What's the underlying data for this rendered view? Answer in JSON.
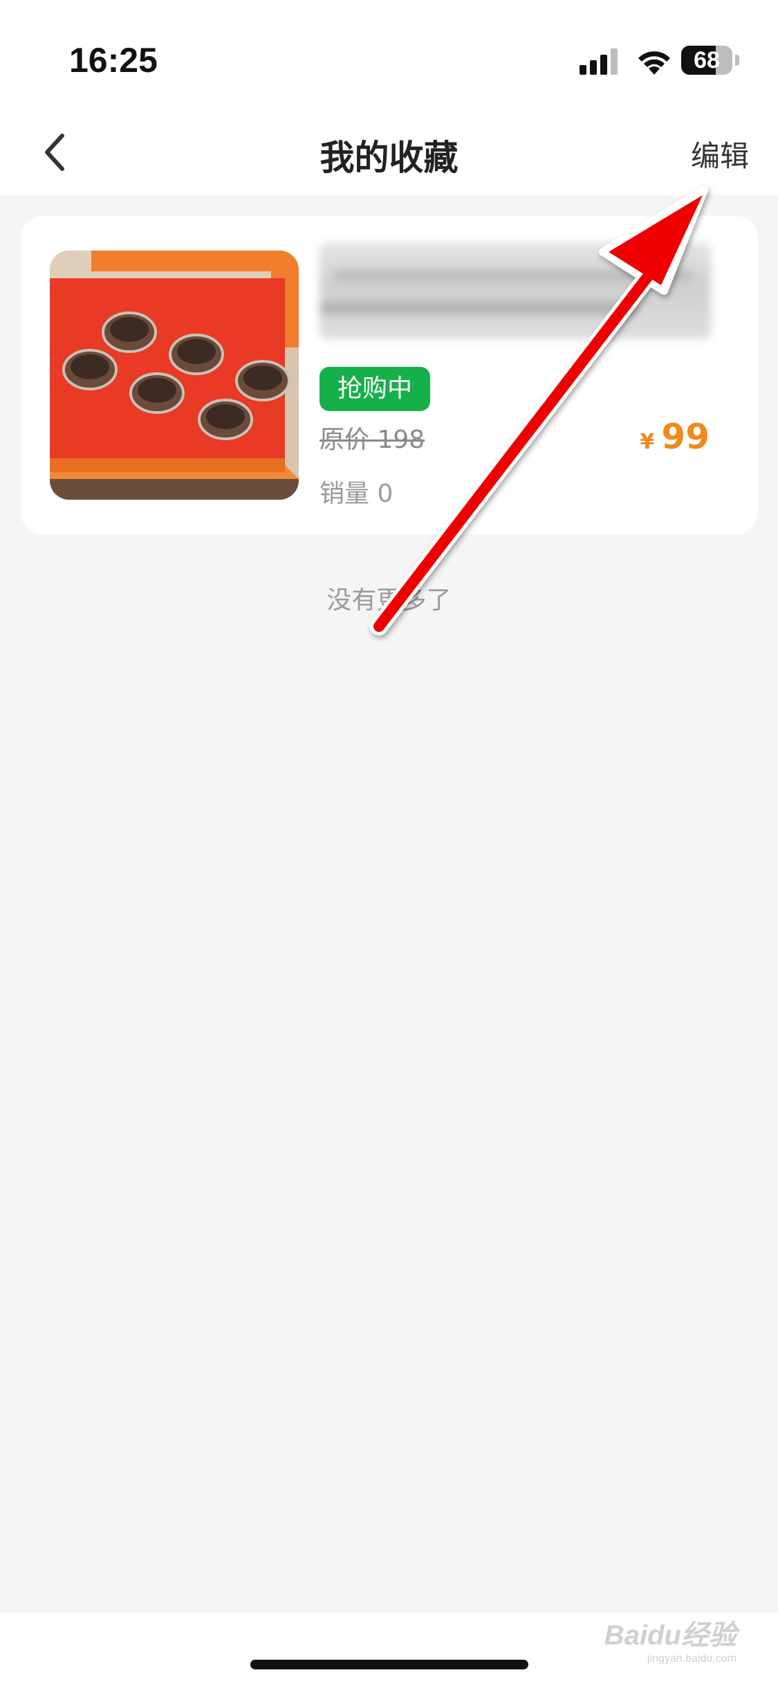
{
  "status_bar": {
    "time": "16:25",
    "battery_level": "68",
    "battery_fraction": 0.68,
    "icons": [
      "cellular-signal-icon",
      "wifi-icon",
      "battery-icon"
    ]
  },
  "nav": {
    "title": "我的收藏",
    "edit_label": "编辑",
    "back_icon": "chevron-left-icon"
  },
  "favorites": [
    {
      "status_badge": "抢购中",
      "original_price": "原价 198",
      "sales": "销量 0",
      "currency": "¥",
      "price": "99"
    }
  ],
  "list_end_text": "没有更多了",
  "watermark": {
    "brand": "Baidu经验",
    "url": "jingyan.baidu.com"
  },
  "colors": {
    "page_bg": "#f5f5f5",
    "badge_green": "#16b04a",
    "price_orange": "#f08a1c",
    "annotation_arrow_red": "#ee0000"
  }
}
